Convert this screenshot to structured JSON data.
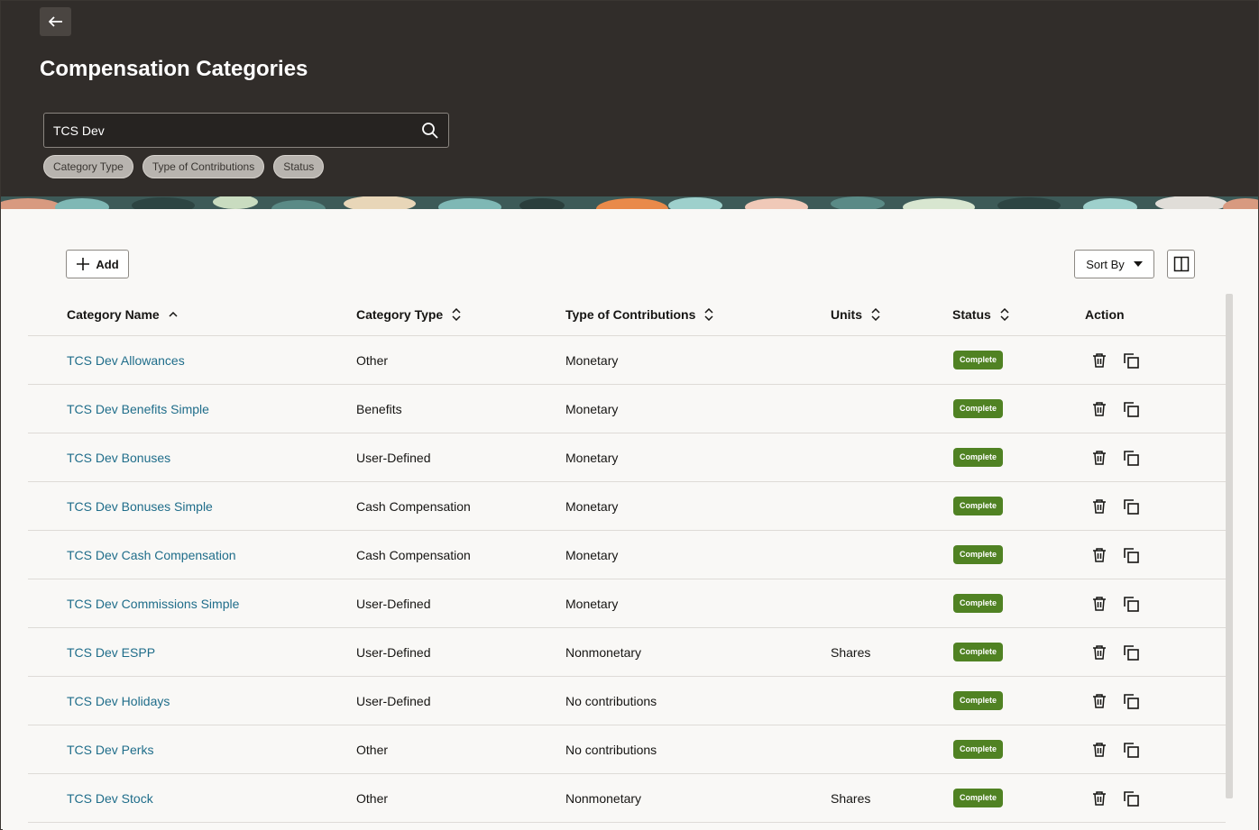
{
  "header": {
    "title": "Compensation Categories",
    "search_value": "TCS Dev",
    "filters": [
      "Category Type",
      "Type of Contributions",
      "Status"
    ]
  },
  "toolbar": {
    "add_label": "Add",
    "sort_label": "Sort By"
  },
  "table": {
    "columns": [
      "Category Name",
      "Category Type",
      "Type of Contributions",
      "Units",
      "Status",
      "Action"
    ],
    "rows": [
      {
        "name": "TCS Dev Allowances",
        "type": "Other",
        "contrib": "Monetary",
        "units": "",
        "status": "Complete"
      },
      {
        "name": "TCS Dev Benefits Simple",
        "type": "Benefits",
        "contrib": "Monetary",
        "units": "",
        "status": "Complete"
      },
      {
        "name": "TCS Dev Bonuses",
        "type": "User-Defined",
        "contrib": "Monetary",
        "units": "",
        "status": "Complete"
      },
      {
        "name": "TCS Dev Bonuses Simple",
        "type": "Cash Compensation",
        "contrib": "Monetary",
        "units": "",
        "status": "Complete"
      },
      {
        "name": "TCS Dev Cash Compensation",
        "type": "Cash Compensation",
        "contrib": "Monetary",
        "units": "",
        "status": "Complete"
      },
      {
        "name": "TCS Dev Commissions Simple",
        "type": "User-Defined",
        "contrib": "Monetary",
        "units": "",
        "status": "Complete"
      },
      {
        "name": "TCS Dev ESPP",
        "type": "User-Defined",
        "contrib": "Nonmonetary",
        "units": "Shares",
        "status": "Complete"
      },
      {
        "name": "TCS Dev Holidays",
        "type": "User-Defined",
        "contrib": "No contributions",
        "units": "",
        "status": "Complete"
      },
      {
        "name": "TCS Dev Perks",
        "type": "Other",
        "contrib": "No contributions",
        "units": "",
        "status": "Complete"
      },
      {
        "name": "TCS Dev Stock",
        "type": "Other",
        "contrib": "Nonmonetary",
        "units": "Shares",
        "status": "Complete"
      }
    ]
  },
  "colors": {
    "header_bg": "#312d2a",
    "link": "#1f6d8a",
    "status_complete": "#508223"
  },
  "icons": [
    "back-arrow-icon",
    "search-icon",
    "plus-icon",
    "caret-down-icon",
    "columns-icon",
    "sort-asc-icon",
    "sort-icon",
    "delete-icon",
    "duplicate-icon"
  ]
}
